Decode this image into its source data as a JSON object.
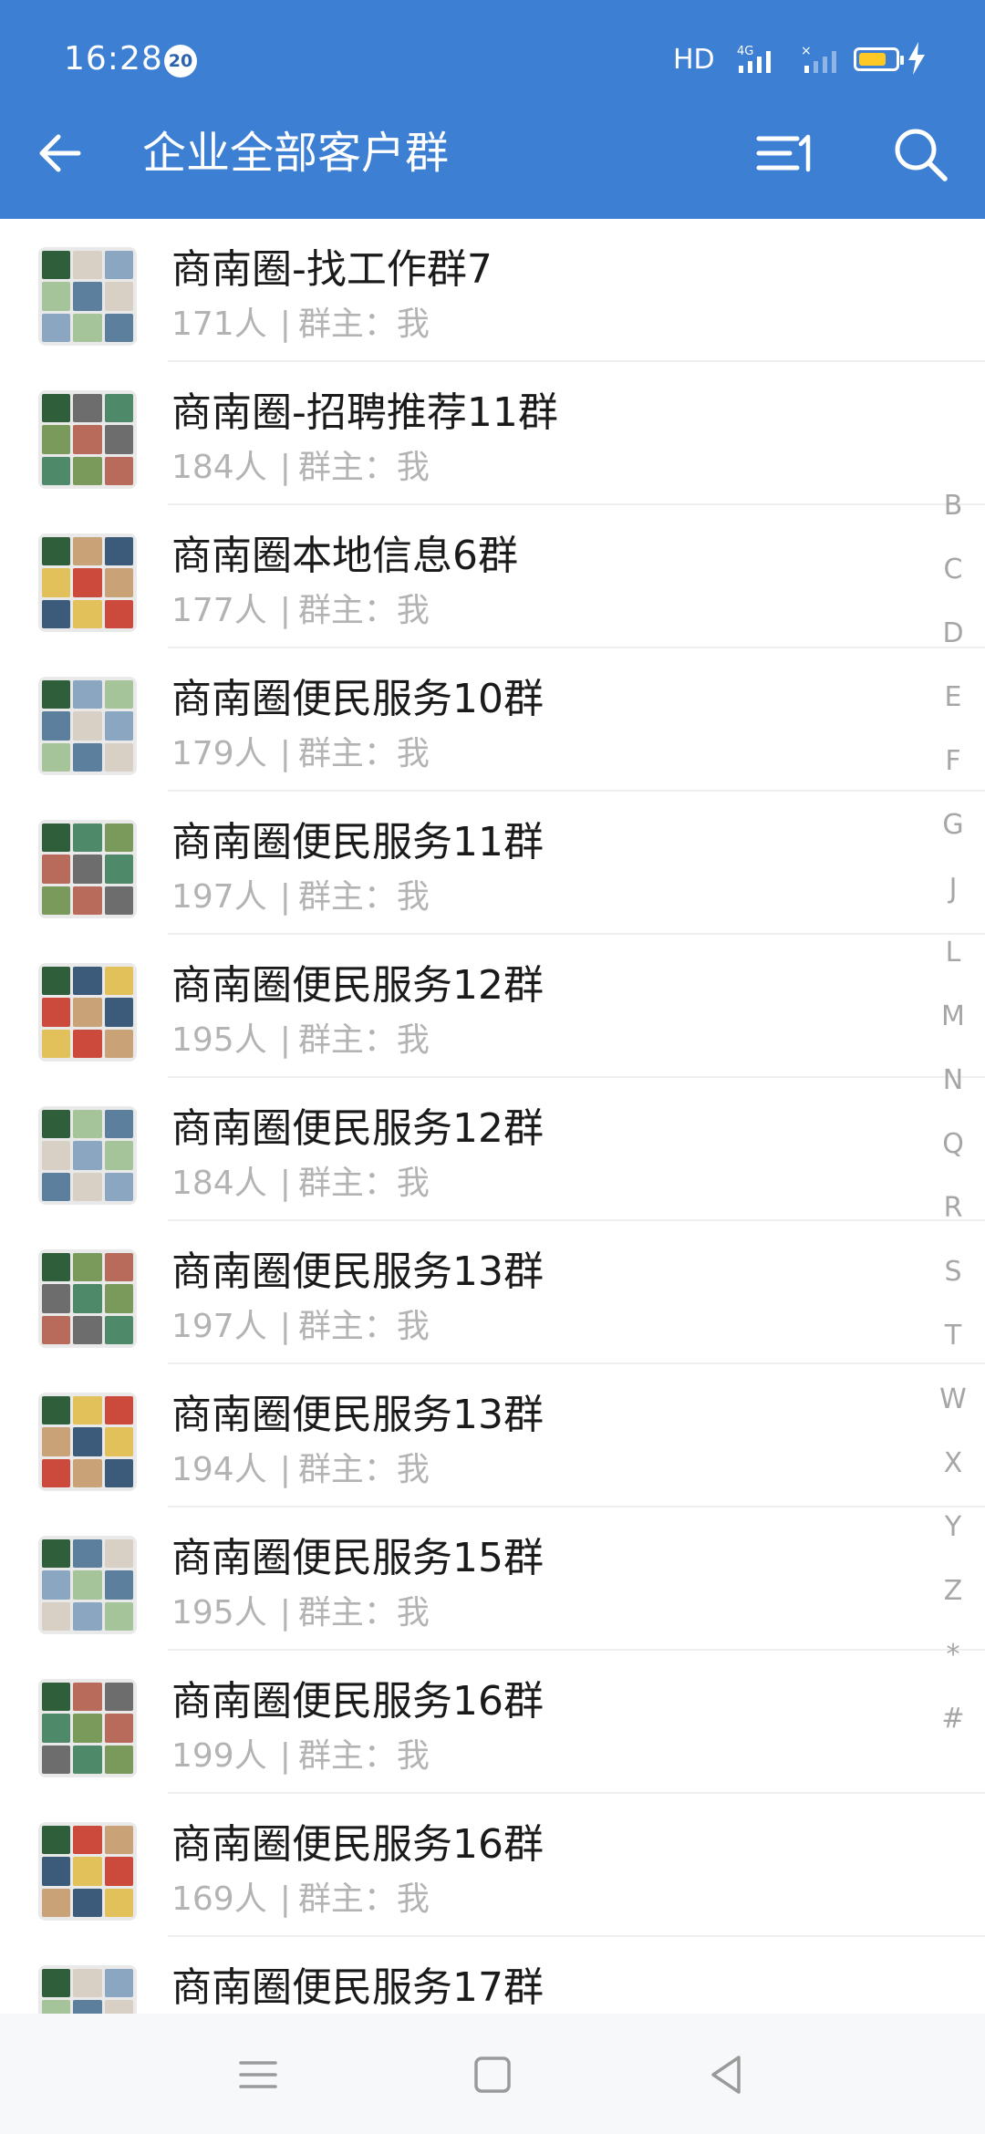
{
  "status_bar": {
    "time": "16:28",
    "notification_count": "20",
    "network_label": "HD",
    "signal_label": "4G",
    "battery_level": 0.75,
    "battery_color": "#ffc825"
  },
  "header": {
    "title": "企业全部客户群",
    "back_icon": "arrow-left-icon",
    "sort_icon": "sort-icon",
    "search_icon": "search-icon",
    "background": "#3d7fd3"
  },
  "groups": [
    {
      "name": "商南圈-找工作群7",
      "count": "171人",
      "owner_label": "群主：我"
    },
    {
      "name": "商南圈-招聘推荐11群",
      "count": "184人",
      "owner_label": "群主：我"
    },
    {
      "name": "商南圈本地信息6群",
      "count": "177人",
      "owner_label": "群主：我"
    },
    {
      "name": "商南圈便民服务10群",
      "count": "179人",
      "owner_label": "群主：我"
    },
    {
      "name": "商南圈便民服务11群",
      "count": "197人",
      "owner_label": "群主：我"
    },
    {
      "name": "商南圈便民服务12群",
      "count": "195人",
      "owner_label": "群主：我"
    },
    {
      "name": "商南圈便民服务12群",
      "count": "184人",
      "owner_label": "群主：我"
    },
    {
      "name": "商南圈便民服务13群",
      "count": "197人",
      "owner_label": "群主：我"
    },
    {
      "name": "商南圈便民服务13群",
      "count": "194人",
      "owner_label": "群主：我"
    },
    {
      "name": "商南圈便民服务15群",
      "count": "195人",
      "owner_label": "群主：我"
    },
    {
      "name": "商南圈便民服务16群",
      "count": "199人",
      "owner_label": "群主：我"
    },
    {
      "name": "商南圈便民服务16群",
      "count": "169人",
      "owner_label": "群主：我"
    },
    {
      "name": "商南圈便民服务17群",
      "count": "",
      "owner_label": ""
    }
  ],
  "separator": "|",
  "index_letters": [
    "B",
    "C",
    "D",
    "E",
    "F",
    "G",
    "J",
    "L",
    "M",
    "N",
    "Q",
    "R",
    "S",
    "T",
    "W",
    "X",
    "Y",
    "Z",
    "*",
    "#"
  ],
  "nav_bar": {
    "menu_icon": "menu-icon",
    "home_icon": "home-square-icon",
    "back_icon": "back-triangle-icon"
  }
}
